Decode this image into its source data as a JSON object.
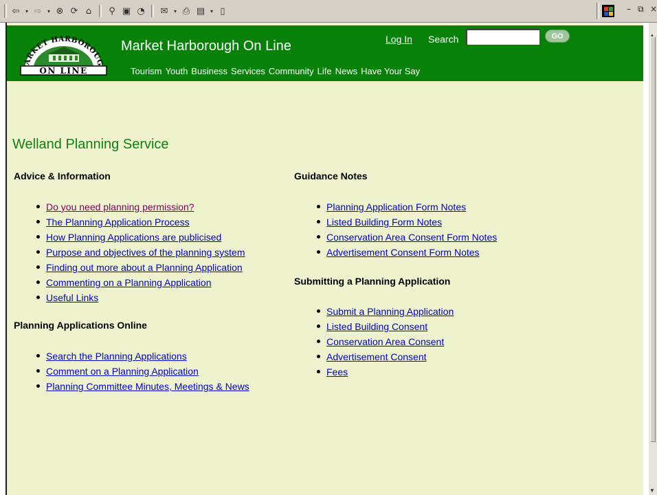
{
  "colors": {
    "header_green": "#078107",
    "page_bg": "#eef3cd",
    "title_green": "#107f10",
    "link": "#0000cc",
    "visited_link": "#800060"
  },
  "toolbar": {
    "icons": [
      "back-icon",
      "forward-icon",
      "stop-icon",
      "refresh-icon",
      "home-icon",
      "search-icon",
      "favorites-icon",
      "history-icon",
      "mail-icon",
      "print-icon",
      "edit-icon",
      "discuss-icon"
    ]
  },
  "header": {
    "logo_top_text": "MARKET HARBOROUGH",
    "logo_bottom_text": "ON LINE",
    "site_title": "Market Harborough On Line",
    "login_label": "Log In",
    "search_label": "Search",
    "search_value": "",
    "go_label": "GO",
    "nav": [
      "Tourism",
      "Youth",
      "Business",
      "Services",
      "Community",
      "Life",
      "News",
      "Have Your Say"
    ]
  },
  "main": {
    "title": "Welland Planning Service",
    "advice": {
      "heading": "Advice & Information",
      "links": [
        "Do you need planning permission?",
        "The Planning Application Process",
        "How Planning Applications are publicised",
        "Purpose and objectives of the planning system",
        "Finding out more about a Planning Application",
        "Commenting on a Planning Application",
        "Useful Links"
      ]
    },
    "online": {
      "heading": "Planning Applications Online",
      "links": [
        "Search the Planning Applications",
        "Comment on a Planning Application",
        "Planning Committee Minutes, Meetings & News"
      ]
    },
    "guidance": {
      "heading": "Guidance Notes",
      "links": [
        "Planning Application Form Notes",
        "Listed Building Form Notes",
        "Conservation Area Consent Form Notes",
        "Advertisement Consent Form Notes"
      ]
    },
    "submit": {
      "heading": "Submitting a Planning Application",
      "links": [
        "Submit a Planning Application",
        "Listed Building Consent",
        "Conservation Area Consent",
        "Advertisement Consent",
        "Fees"
      ]
    }
  }
}
